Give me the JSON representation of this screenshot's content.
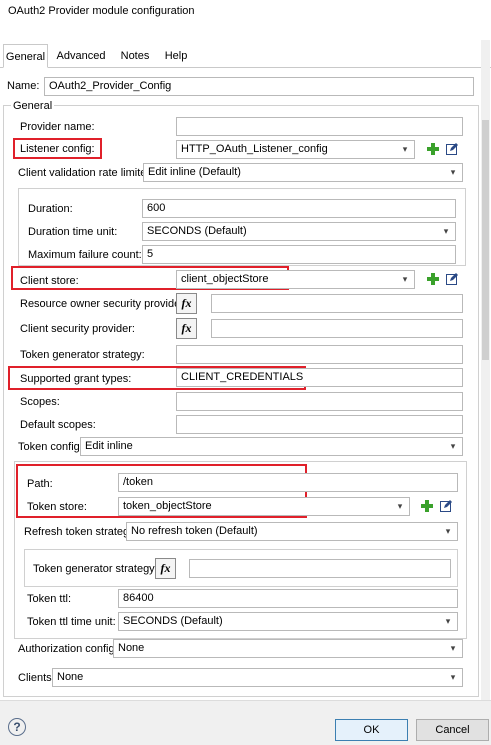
{
  "window": {
    "title": "OAuth2 Provider module configuration"
  },
  "tabs": [
    {
      "label": "General",
      "active": true
    },
    {
      "label": "Advanced",
      "active": false
    },
    {
      "label": "Notes",
      "active": false
    },
    {
      "label": "Help",
      "active": false
    }
  ],
  "name": {
    "label": "Name:",
    "value": "OAuth2_Provider_Config"
  },
  "general_group": {
    "label": "General"
  },
  "provider_name": {
    "label": "Provider name:",
    "value": ""
  },
  "listener_config": {
    "label": "Listener config:",
    "value": "HTTP_OAuth_Listener_config"
  },
  "client_validation_rate_limiter": {
    "label": "Client validation rate limiter",
    "value": "Edit inline (Default)"
  },
  "rate_limiter": {
    "duration": {
      "label": "Duration:",
      "value": "600"
    },
    "duration_time_unit": {
      "label": "Duration time unit:",
      "value": "SECONDS (Default)"
    },
    "max_failure_count": {
      "label": "Maximum failure count:",
      "value": "5"
    }
  },
  "client_store": {
    "label": "Client store:",
    "value": "client_objectStore"
  },
  "resource_owner_security_provider": {
    "label": "Resource owner security provider:",
    "value": ""
  },
  "client_security_provider": {
    "label": "Client security provider:",
    "value": ""
  },
  "token_generator_strategy": {
    "label": "Token generator strategy:",
    "value": ""
  },
  "supported_grant_types": {
    "label": "Supported grant types:",
    "value": "CLIENT_CREDENTIALS"
  },
  "scopes": {
    "label": "Scopes:",
    "value": ""
  },
  "default_scopes": {
    "label": "Default scopes:",
    "value": ""
  },
  "token_config": {
    "label": "Token config",
    "value": "Edit inline"
  },
  "token": {
    "path": {
      "label": "Path:",
      "value": "/token"
    },
    "token_store": {
      "label": "Token store:",
      "value": "token_objectStore"
    },
    "refresh_token_strategy": {
      "label": "Refresh token strategy",
      "value": "No refresh token (Default)"
    },
    "token_generator_strategy": {
      "label": "Token generator strategy:",
      "value": ""
    },
    "token_ttl": {
      "label": "Token ttl:",
      "value": "86400"
    },
    "token_ttl_time_unit": {
      "label": "Token ttl time unit:",
      "value": "SECONDS (Default)"
    }
  },
  "authorization_config": {
    "label": "Authorization config",
    "value": "None"
  },
  "clients": {
    "label": "Clients",
    "value": "None"
  },
  "icons": {
    "fx": "fx",
    "chevron": "▾",
    "help": "?"
  },
  "buttons": {
    "ok": "OK",
    "cancel": "Cancel"
  },
  "colors": {
    "highlight": "#e0202a",
    "add_icon": "#3aa12b"
  }
}
